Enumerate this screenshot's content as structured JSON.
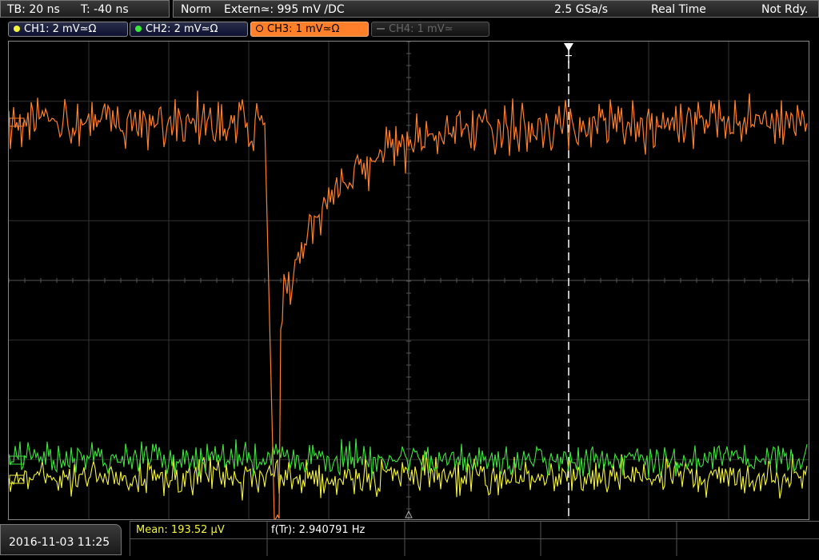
{
  "timebase": {
    "tb": "TB: 20 ns",
    "trig_time": "T: -40 ns"
  },
  "status": {
    "mode": "Norm",
    "trigger": "Extern≃: 995 mV ∕DC",
    "sample_rate": "2.5 GSa/s",
    "acq_mode": "Real Time",
    "state": "Not Rdy."
  },
  "channels": [
    {
      "label": "CH1: 2 mV≃Ω",
      "color": "#f5f53c",
      "state": "on"
    },
    {
      "label": "CH2: 2 mV≃Ω",
      "color": "#3ce63c",
      "state": "on"
    },
    {
      "label": "CH3: 1 mV≃Ω",
      "color": "#ff7f2a",
      "state": "active"
    },
    {
      "label": "CH4: 1 mV≃",
      "color": "#666666",
      "state": "off"
    }
  ],
  "trigger_marker": "T",
  "datetime": "2016-11-03 11:25",
  "measurements": {
    "mean": "Mean: 193.52 µV",
    "freq": "f(Tr): 2.940791 Hz"
  },
  "colors": {
    "ch1": "#f5f53c",
    "ch2": "#3ce63c",
    "ch3": "#ff7f2a",
    "grid": "#3a3a3a",
    "trigger_line": "#ffffff"
  },
  "icons": [
    "trigger-marker-icon",
    "ground-marker-icon",
    "channel-dot-icon"
  ]
}
